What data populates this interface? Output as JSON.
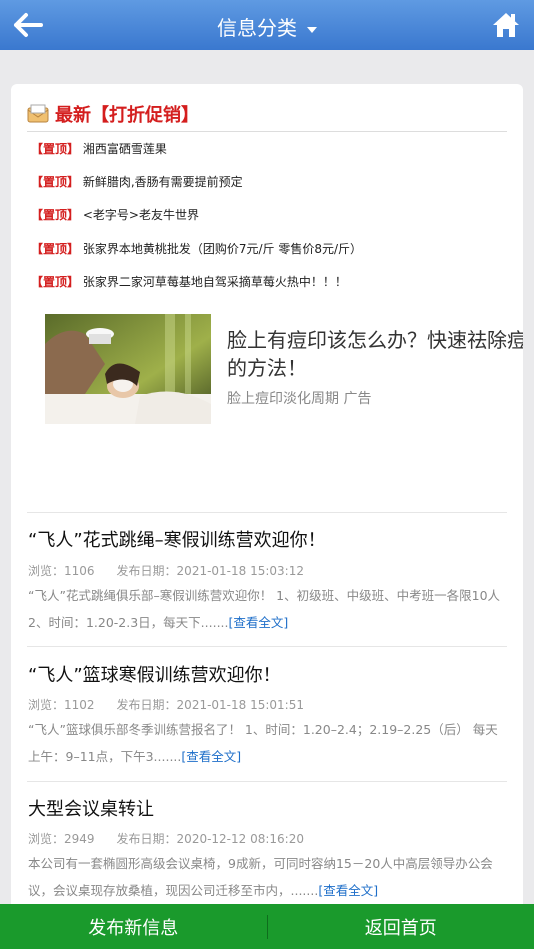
{
  "header": {
    "title": "信息分类"
  },
  "section": {
    "title": "最新【打折促销】"
  },
  "promos": [
    {
      "tag": "【置顶】",
      "text": "湘西富硒雪莲果"
    },
    {
      "tag": "【置顶】",
      "text": "新鲜腊肉,香肠有需要提前预定"
    },
    {
      "tag": "【置顶】",
      "text": "<老字号>老友牛世界"
    },
    {
      "tag": "【置顶】",
      "text": "张家界本地黄桃批发（团购价7元/斤 零售价8元/斤）"
    },
    {
      "tag": "【置顶】",
      "text": "张家界二家河草莓基地自驾采摘草莓火热中！！！"
    }
  ],
  "ad": {
    "headline_line1": "脸上有痘印该怎么办？快速祛除痘印",
    "headline_line2": "的方法！",
    "subtitle": "脸上痘印淡化周期  广告"
  },
  "items": [
    {
      "title": "“飞人”花式跳绳–寒假训练营欢迎你！",
      "views_label": "浏览：1106",
      "date_label": "发布日期：2021-01-18 15:03:12",
      "desc": "“飞人”花式跳绳俱乐部–寒假训练营欢迎你！ 1、初级班、中级班、中考班一各限10人 2、时间：1.20-2.3日，每天下.......",
      "more": "[查看全文]"
    },
    {
      "title": "“飞人”篮球寒假训练营欢迎你！",
      "views_label": "浏览：1102",
      "date_label": "发布日期：2021-01-18 15:01:51",
      "desc": "“飞人”篮球俱乐部冬季训练营报名了！ 1、时间：1.20–2.4；2.19–2.25（后） 每天上午：9–11点，下午3.......",
      "more": "[查看全文]"
    },
    {
      "title": "大型会议桌转让",
      "views_label": "浏览：2949",
      "date_label": "发布日期：2020-12-12 08:16:20",
      "desc": "本公司有一套椭圆形高级会议桌椅，9成新，可同时容纳15－20人中高层领导办公会议，会议桌现存放桑植，现因公司迁移至市内，.......",
      "more": "[查看全文]"
    }
  ],
  "footer": {
    "publish": "发布新信息",
    "home": "返回首页"
  },
  "colors": {
    "header": "#3a78cf",
    "accent_red": "#d41e1e",
    "link": "#1f6fc9",
    "footer": "#1a9a2c"
  }
}
